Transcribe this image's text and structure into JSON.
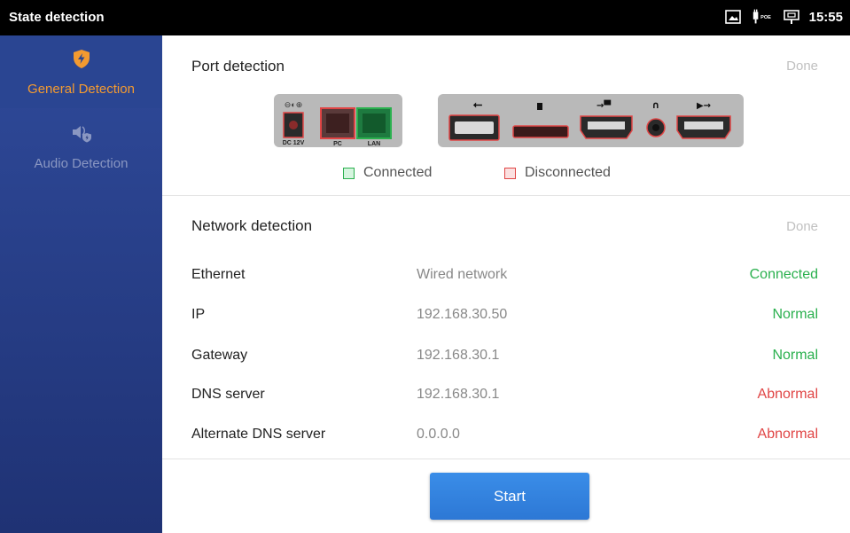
{
  "statusbar": {
    "title": "State detection",
    "time": "15:55",
    "icons": [
      "screen-icon",
      "poe-icon",
      "ethernet-icon"
    ]
  },
  "sidebar": {
    "items": [
      {
        "label": "General Detection",
        "icon": "shield-bolt-icon",
        "active": true,
        "color": "#f39a30"
      },
      {
        "label": "Audio Detection",
        "icon": "speaker-shield-icon",
        "active": false
      }
    ]
  },
  "port_detection": {
    "title": "Port detection",
    "done_label": "Done",
    "ports": [
      {
        "label": "DC 12V",
        "state": "Disconnected"
      },
      {
        "label": "PC",
        "state": "Disconnected"
      },
      {
        "label": "LAN",
        "state": "Connected"
      },
      {
        "label": "USB",
        "state": "Disconnected"
      },
      {
        "label": "SD",
        "state": "Disconnected"
      },
      {
        "label": "HDMI In",
        "state": "Disconnected"
      },
      {
        "label": "Headset",
        "state": "Disconnected"
      },
      {
        "label": "HDMI Out",
        "state": "Disconnected"
      }
    ],
    "legend": {
      "connected": "Connected",
      "disconnected": "Disconnected",
      "connected_color": "#2ab04e",
      "disconnected_color": "#e04545"
    }
  },
  "network_detection": {
    "title": "Network detection",
    "done_label": "Done",
    "rows": [
      {
        "name": "Ethernet",
        "value": "Wired network",
        "status": "Connected",
        "ok": true
      },
      {
        "name": "IP",
        "value": "192.168.30.50",
        "status": "Normal",
        "ok": true
      },
      {
        "name": "Gateway",
        "value": "192.168.30.1",
        "status": "Normal",
        "ok": true
      },
      {
        "name": "DNS server",
        "value": "192.168.30.1",
        "status": "Abnormal",
        "ok": false
      },
      {
        "name": "Alternate DNS server",
        "value": "0.0.0.0",
        "status": "Abnormal",
        "ok": false
      }
    ]
  },
  "actions": {
    "start_label": "Start"
  }
}
